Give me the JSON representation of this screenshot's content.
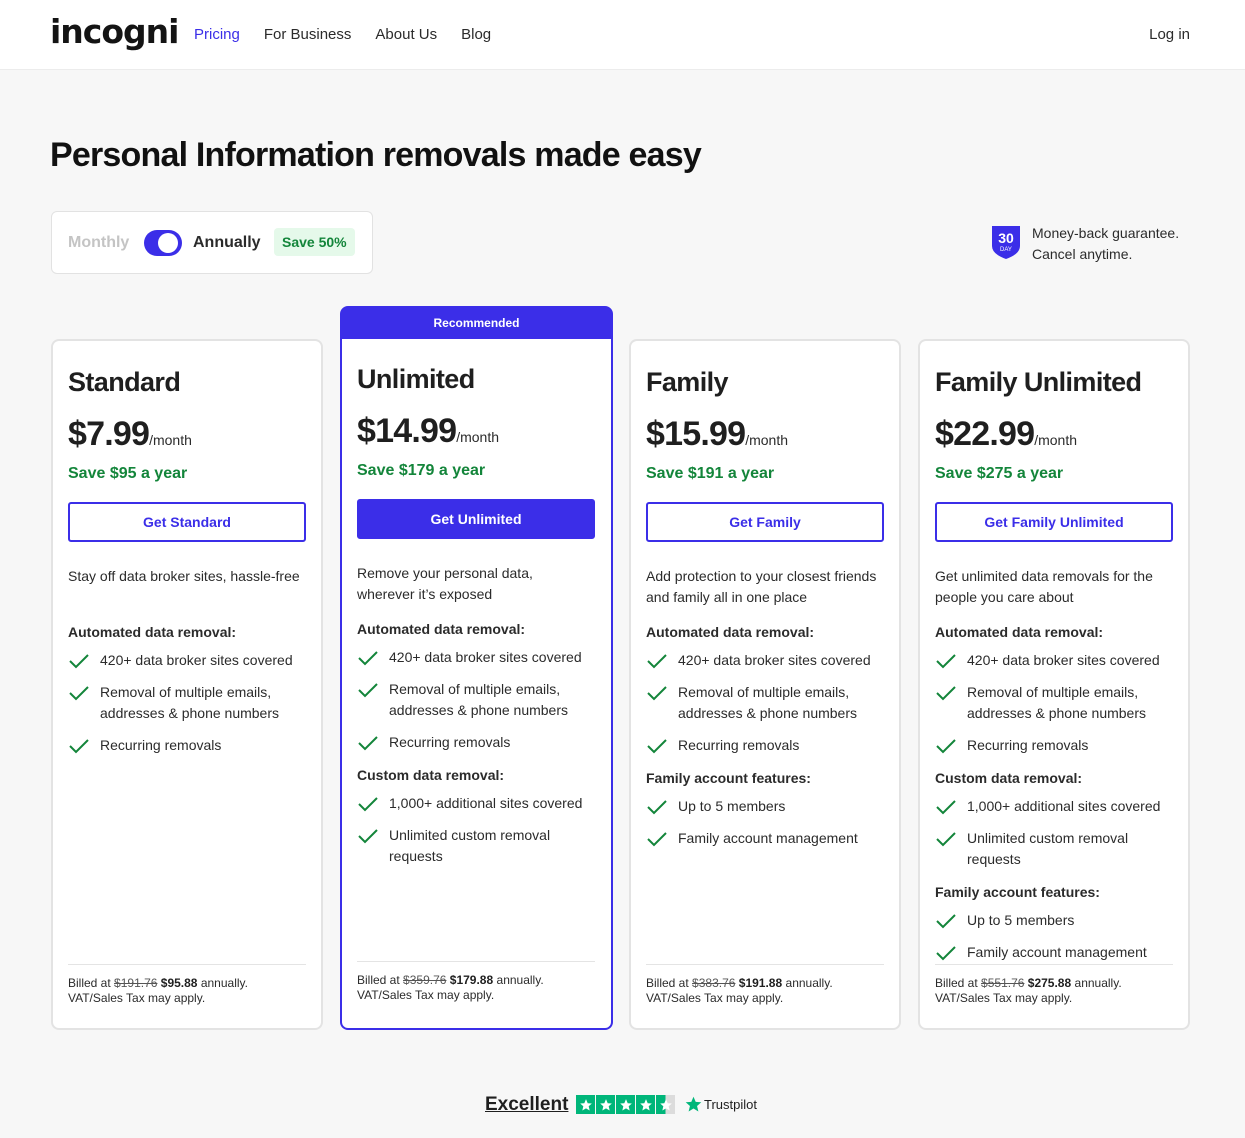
{
  "header": {
    "logo": "incogni",
    "nav": [
      "Pricing",
      "For Business",
      "About Us",
      "Blog"
    ],
    "login": "Log in"
  },
  "hero": {
    "title": "Personal Information removals made easy"
  },
  "billing_toggle": {
    "monthly": "Monthly",
    "annually": "Annually",
    "save_badge": "Save 50%"
  },
  "guarantee": {
    "badge_number": "30",
    "badge_unit": "DAY",
    "line1": "Money-back guarantee.",
    "line2": "Cancel anytime."
  },
  "recommended_label": "Recommended",
  "per_month": "/month",
  "plans": [
    {
      "name": "Standard",
      "price": "$7.99",
      "save": "Save $95 a year",
      "cta": "Get Standard",
      "desc": "Stay off data broker sites, hassle-free",
      "sections": [
        {
          "title": "Automated data removal:",
          "items": [
            "420+ data broker sites covered",
            "Removal of multiple emails, addresses & phone numbers",
            "Recurring removals"
          ]
        }
      ],
      "billed_prefix": "Billed at",
      "billed_old": "$191.76",
      "billed_new": "$95.88",
      "billed_suffix": "annually.",
      "tax": "VAT/Sales Tax may apply."
    },
    {
      "name": "Unlimited",
      "price": "$14.99",
      "save": "Save $179 a year",
      "cta": "Get Unlimited",
      "desc": "Remove your personal data, wherever it’s exposed",
      "sections": [
        {
          "title": "Automated data removal:",
          "items": [
            "420+ data broker sites covered",
            "Removal of multiple emails, addresses & phone numbers",
            "Recurring removals"
          ]
        },
        {
          "title": "Custom data removal:",
          "items": [
            "1,000+ additional sites covered",
            "Unlimited custom removal requests"
          ]
        }
      ],
      "billed_prefix": "Billed at",
      "billed_old": "$359.76",
      "billed_new": "$179.88",
      "billed_suffix": "annually.",
      "tax": "VAT/Sales Tax may apply."
    },
    {
      "name": "Family",
      "price": "$15.99",
      "save": "Save $191 a year",
      "cta": "Get Family",
      "desc": "Add protection to your closest friends and family all in one place",
      "sections": [
        {
          "title": "Automated data removal:",
          "items": [
            "420+ data broker sites covered",
            "Removal of multiple emails, addresses & phone numbers",
            "Recurring removals"
          ]
        },
        {
          "title": "Family account features:",
          "items": [
            "Up to 5 members",
            "Family account management"
          ]
        }
      ],
      "billed_prefix": "Billed at",
      "billed_old": "$383.76",
      "billed_new": "$191.88",
      "billed_suffix": "annually.",
      "tax": "VAT/Sales Tax may apply."
    },
    {
      "name": "Family Unlimited",
      "price": "$22.99",
      "save": "Save $275 a year",
      "cta": "Get Family Unlimited",
      "desc": "Get unlimited data removals for the people you care about",
      "sections": [
        {
          "title": "Automated data removal:",
          "items": [
            "420+ data broker sites covered",
            "Removal of multiple emails, addresses & phone numbers",
            "Recurring removals"
          ]
        },
        {
          "title": "Custom data removal:",
          "items": [
            "1,000+ additional sites covered",
            "Unlimited custom removal requests"
          ]
        },
        {
          "title": "Family account features:",
          "items": [
            "Up to 5 members",
            "Family account management"
          ]
        }
      ],
      "billed_prefix": "Billed at",
      "billed_old": "$551.76",
      "billed_new": "$275.88",
      "billed_suffix": "annually.",
      "tax": "VAT/Sales Tax may apply."
    }
  ],
  "trustpilot": {
    "rating_label": "Excellent",
    "stars": 4.5,
    "brand": "Trustpilot"
  },
  "colors": {
    "accent": "#3b2ee8",
    "save_green": "#13853a",
    "trustpilot_green": "#00b67a"
  }
}
